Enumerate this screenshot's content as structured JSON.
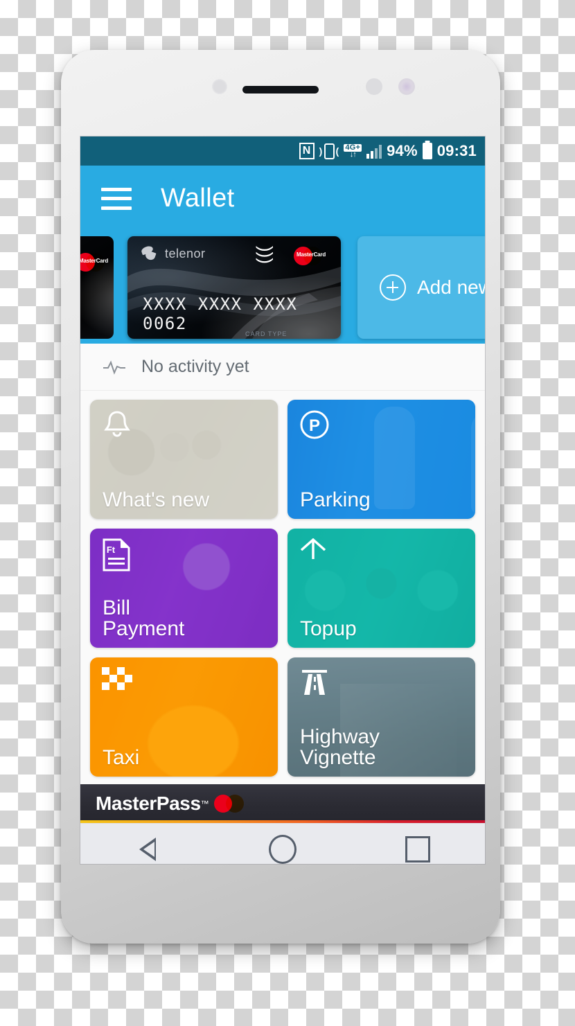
{
  "device": {
    "type": "smartphone"
  },
  "statusbar": {
    "icons": [
      "nfc-icon",
      "vibrate-icon",
      "network-4g-plus-icon",
      "signal-bars-icon",
      "battery-icon"
    ],
    "nfc_glyph": "N",
    "network_label": "4G+",
    "network_arrows": "↓↑",
    "battery_percent": "94%",
    "clock": "09:31",
    "background_color": "#11607a"
  },
  "appbar": {
    "menu_icon": "hamburger-menu-icon",
    "title": "Wallet",
    "background_color": "#29abe2"
  },
  "carousel": {
    "previous_card": {
      "brand_logo": "mastercard-logo",
      "visible_digits": "4"
    },
    "active_card": {
      "issuer": "telenor",
      "contactless_icon": "contactless-payment-icon",
      "brand_logo": "mastercard-logo",
      "brand_label": "MasterCard",
      "number": "XXXX XXXX XXXX 0062",
      "card_type_label": "CARD TYPE"
    },
    "add_card": {
      "icon": "plus-circle-icon",
      "label": "Add new b",
      "background_color": "#4cb9e7"
    }
  },
  "activity": {
    "icon": "pulse-activity-icon",
    "text": "No activity yet"
  },
  "tiles": [
    {
      "id": "whats-new",
      "label": "What's new",
      "icon": "bell-icon",
      "color": "#d0cec4"
    },
    {
      "id": "parking",
      "label": "Parking",
      "icon": "parking-p-icon",
      "color": "#188de8"
    },
    {
      "id": "bill-payment",
      "label": "Bill\nPayment",
      "label_line1": "Bill",
      "label_line2": "Payment",
      "icon": "invoice-ft-icon",
      "color": "#7e2dc6"
    },
    {
      "id": "topup",
      "label": "Topup",
      "icon": "arrow-up-icon",
      "color": "#11b2a4"
    },
    {
      "id": "taxi",
      "label": "Taxi",
      "icon": "checkered-flag-icon",
      "color": "#fa9600"
    },
    {
      "id": "highway-vignette",
      "label": "Highway\nVignette",
      "label_line1": "Highway",
      "label_line2": "Vignette",
      "icon": "motorway-icon",
      "color": "#5f7882"
    }
  ],
  "masterpass": {
    "name": "MasterPass",
    "trademark": "™",
    "logo": "mastercard-logo",
    "background_color": "#2b2b33"
  },
  "navbar": {
    "back": "back-triangle-icon",
    "home": "home-circle-icon",
    "recents": "recents-square-icon"
  }
}
